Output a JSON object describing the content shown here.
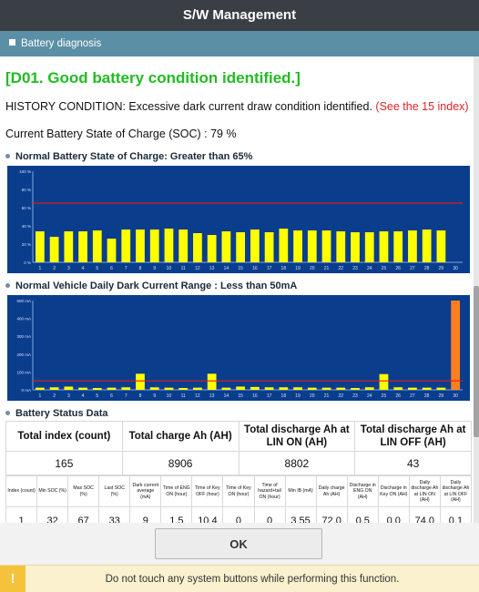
{
  "window": {
    "title": "S/W Management"
  },
  "section": {
    "label": "Battery diagnosis"
  },
  "diagnosis": {
    "headline": "[D01. Good battery condition identified.]",
    "history_text": "HISTORY CONDITION: Excessive dark current draw condition identified.",
    "history_link": "(See the 15 index)",
    "soc_text": "Current Battery State of Charge (SOC) : 79 %"
  },
  "colors": {
    "bar_yellow": "#ffff00",
    "bar_orange": "#ff7f1f",
    "chart_bg": "#0b3d8d",
    "threshold_red": "#e11d1d",
    "headline_green": "#22bb22"
  },
  "chart_data": [
    {
      "type": "bar",
      "title": "Normal Battery State of Charge: Greater than 65%",
      "categories": [
        "1",
        "2",
        "3",
        "4",
        "5",
        "6",
        "7",
        "8",
        "9",
        "10",
        "11",
        "12",
        "13",
        "14",
        "15",
        "16",
        "17",
        "18",
        "19",
        "20",
        "21",
        "22",
        "23",
        "24",
        "25",
        "26",
        "27",
        "28",
        "29",
        "30"
      ],
      "values": [
        34,
        28,
        34,
        34,
        35,
        26,
        36,
        36,
        36,
        37,
        36,
        32,
        30,
        34,
        33,
        36,
        33,
        37,
        35,
        35,
        35,
        34,
        33,
        33,
        34,
        34,
        35,
        36,
        35,
        0
      ],
      "threshold": 65,
      "ylim": [
        0,
        100
      ],
      "yticks": [
        "0 %",
        "20 %",
        "40 %",
        "60 %",
        "80 %",
        "100 %"
      ],
      "grid": false
    },
    {
      "type": "bar",
      "title": "Normal Vehicle Daily Dark Current Range : Less than 50mA",
      "categories": [
        "1",
        "2",
        "3",
        "4",
        "5",
        "6",
        "7",
        "8",
        "9",
        "10",
        "11",
        "12",
        "13",
        "14",
        "15",
        "16",
        "17",
        "18",
        "19",
        "20",
        "21",
        "22",
        "23",
        "24",
        "25",
        "26",
        "27",
        "28",
        "29",
        "30"
      ],
      "values": [
        12,
        14,
        18,
        12,
        10,
        12,
        14,
        90,
        14,
        12,
        10,
        12,
        90,
        12,
        18,
        16,
        14,
        14,
        14,
        12,
        12,
        12,
        10,
        14,
        88,
        14,
        12,
        12,
        12,
        500
      ],
      "highlight_index": 29,
      "threshold": 50,
      "ylim": [
        0,
        500
      ],
      "yticks": [
        "0 mA",
        "100 mA",
        "200 mA",
        "300 mA",
        "400 mA",
        "500 mA"
      ],
      "grid": false
    }
  ],
  "status": {
    "title": "Battery Status Data",
    "summary_headers": [
      "Total index (count)",
      "Total charge Ah (AH)",
      "Total discharge Ah at LIN ON (AH)",
      "Total discharge Ah at LIN OFF (AH)"
    ],
    "summary_values": [
      "165",
      "8906",
      "8802",
      "43"
    ],
    "detail_headers": [
      "Index (count)",
      "Min SOC (%)",
      "Max SOC (%)",
      "Last SOC (%)",
      "Dark current average (mA)",
      "Time of ENG ON (hour)",
      "Time of Key OFF (hour)",
      "Time of Key ON (hour)",
      "Time of hazard+tail ON (hour)",
      "Min IB (mA)",
      "Daily charge Ah (AH)",
      "Discharge in ENG ON (AH)",
      "Discharge in Key ON (AH)",
      "Daily discharge Ah at LIN ON (AH)",
      "Daily discharge Ah at LIN OFF (AH)"
    ],
    "detail_values": [
      "1",
      "32",
      "67",
      "33",
      "9",
      "1.5",
      "10.4",
      "0",
      "0",
      "3.55",
      "72.0",
      "0.5",
      "0.0",
      "74.0",
      "0.1"
    ]
  },
  "footer": {
    "ok_label": "OK",
    "warning_icon": "!",
    "warning_text": "Do not touch any system buttons while performing this function."
  }
}
